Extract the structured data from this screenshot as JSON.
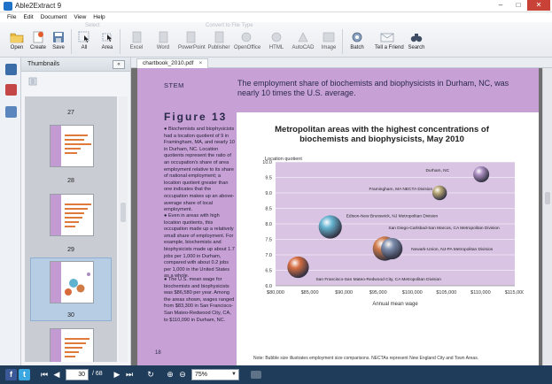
{
  "window": {
    "title": "Able2Extract 9"
  },
  "menu": [
    "File",
    "Edit",
    "Document",
    "View",
    "Help"
  ],
  "toolbar": {
    "group_select": "Select",
    "group_convert": "Convert to File Type",
    "buttons": [
      {
        "label": "Open",
        "icon": "folder-open-icon"
      },
      {
        "label": "Create",
        "icon": "create-pdf-icon"
      },
      {
        "label": "Save",
        "icon": "floppy-disk-icon"
      },
      {
        "label": "All",
        "icon": "select-all-icon"
      },
      {
        "label": "Area",
        "icon": "select-area-icon"
      },
      {
        "label": "Excel",
        "icon": "excel-icon"
      },
      {
        "label": "Word",
        "icon": "word-icon"
      },
      {
        "label": "PowerPoint",
        "icon": "powerpoint-icon"
      },
      {
        "label": "Publisher",
        "icon": "publisher-icon"
      },
      {
        "label": "OpenOffice",
        "icon": "openoffice-icon"
      },
      {
        "label": "HTML",
        "icon": "html-icon"
      },
      {
        "label": "AutoCAD",
        "icon": "autocad-icon"
      },
      {
        "label": "Image",
        "icon": "image-icon"
      },
      {
        "label": "Batch",
        "icon": "batch-gear-icon"
      },
      {
        "label": "Tell a Friend",
        "icon": "envelope-icon"
      },
      {
        "label": "Search",
        "icon": "binoculars-icon"
      }
    ]
  },
  "thumbnails": {
    "header": "Thumbnails",
    "collapse_glyph": "«",
    "pages": [
      "27",
      "28",
      "29",
      "30"
    ],
    "selected_page": "30"
  },
  "document": {
    "tab_name": "chartbook_2010.pdf",
    "tab_close": "×",
    "section": "STEM",
    "headline": "The employment share of biochemists and biophysicists in Durham, NC, was nearly 10 times the U.S. average.",
    "figure_title": "Figure 13",
    "bullets": [
      "Biochemists and biophysicists had a location quotient of 9 in Framingham, MA, and nearly 10 in Durham, NC. Location quotients represent the ratio of an occupation's share of area employment relative to its share of national employment; a location quotient greater than one indicates that the occupation makes up an above-average share of local employment.",
      "Even in areas with high location quotients, this occupation made up a relatively small share of employment. For example, biochemists and biophysicists made up about 1.7 jobs per 1,000 in Durham, compared with about 0.2 jobs per 1,000 in the United States as a whole.",
      "The U.S. mean wage for biochemists and biophysicists was $86,580 per year. Among the areas shown, wages ranged from $83,300 in San Francisco-San Mateo-Redwood City, CA, to $110,090 in Durham, NC."
    ],
    "page_number": "18",
    "note": "Note: Bubble size illustrates employment size comparisons. NECTAs represent New England City and Town Areas."
  },
  "chart_data": {
    "type": "scatter",
    "title": "Metropolitan areas with the highest concentrations of biochemists and biophysicists, May 2010",
    "xlabel": "Annual mean wage",
    "ylabel": "Location quotient",
    "xlim": [
      80000,
      115000
    ],
    "ylim": [
      6.0,
      10.0
    ],
    "x_ticks": [
      "$80,000",
      "$85,000",
      "$90,000",
      "$95,000",
      "$100,000",
      "$105,000",
      "$110,000",
      "$115,000"
    ],
    "y_ticks": [
      "6.0",
      "6.5",
      "7.0",
      "7.5",
      "8.0",
      "8.5",
      "9.0",
      "9.5",
      "10.0"
    ],
    "grid": true,
    "points": [
      {
        "label": "Durham, NC",
        "x": 110090,
        "y": 9.6,
        "size": 1.0,
        "color": "#a98cc0"
      },
      {
        "label": "Framingham, MA NECTA Division",
        "x": 104000,
        "y": 9.0,
        "size": 0.8,
        "color": "#b7a66e"
      },
      {
        "label": "Edison-New Brunswick, NJ Metropolitan Division",
        "x": 88000,
        "y": 7.9,
        "size": 2.5,
        "color": "#5fb3cf"
      },
      {
        "label": "San Diego-Carlsbad-San Marcos, CA Metropolitan Division",
        "x": 96000,
        "y": 7.2,
        "size": 2.8,
        "color": "#d07a45"
      },
      {
        "label": "Newark-Union, NJ-PA Metropolitan Division",
        "x": 97000,
        "y": 7.2,
        "size": 2.1,
        "color": "#7a8eb0"
      },
      {
        "label": "San Francisco-San Mateo-Redwood City, CA Metropolitan Division",
        "x": 83300,
        "y": 6.6,
        "size": 2.1,
        "color": "#d66a3a"
      }
    ]
  },
  "statusbar": {
    "facebook": "f",
    "twitter": "t",
    "current_page": "30",
    "total_pages": "/ 68",
    "zoom": "75%"
  }
}
